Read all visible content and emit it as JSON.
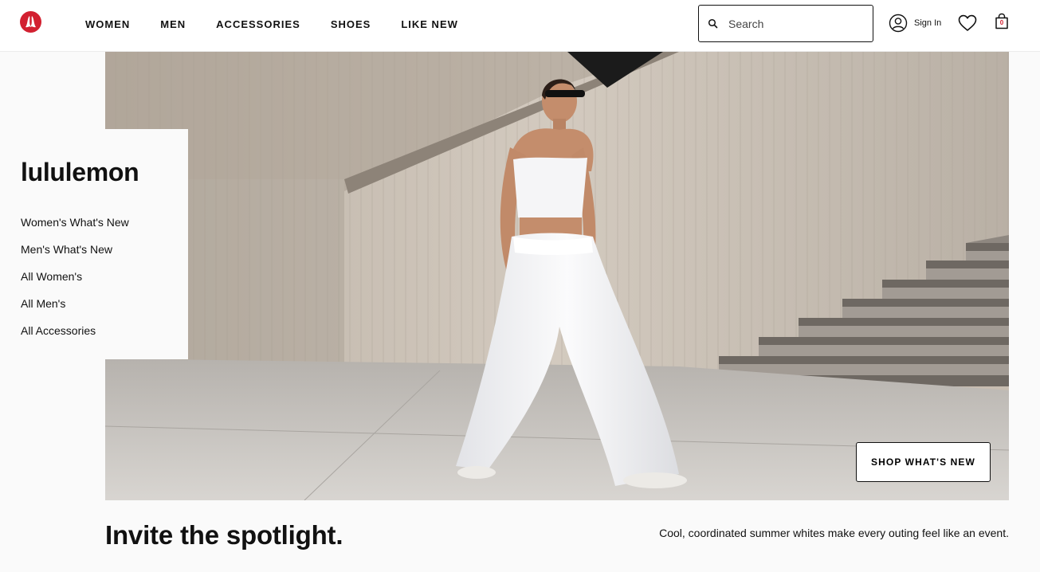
{
  "header": {
    "nav": [
      "WOMEN",
      "MEN",
      "ACCESSORIES",
      "SHOES",
      "LIKE NEW"
    ],
    "search": {
      "placeholder": "Search",
      "value": ""
    },
    "sign_in": "Sign In",
    "bag_count": "0",
    "brand_color": "#d22030"
  },
  "side_panel": {
    "title": "lululemon",
    "links": [
      "Women's What's New",
      "Men's What's New",
      "All Women's",
      "All Men's",
      "All Accessories"
    ]
  },
  "hero": {
    "cta": "SHOP WHAT'S NEW"
  },
  "promo": {
    "headline": "Invite the spotlight.",
    "subcopy": "Cool, coordinated summer whites make every outing feel like an event."
  }
}
